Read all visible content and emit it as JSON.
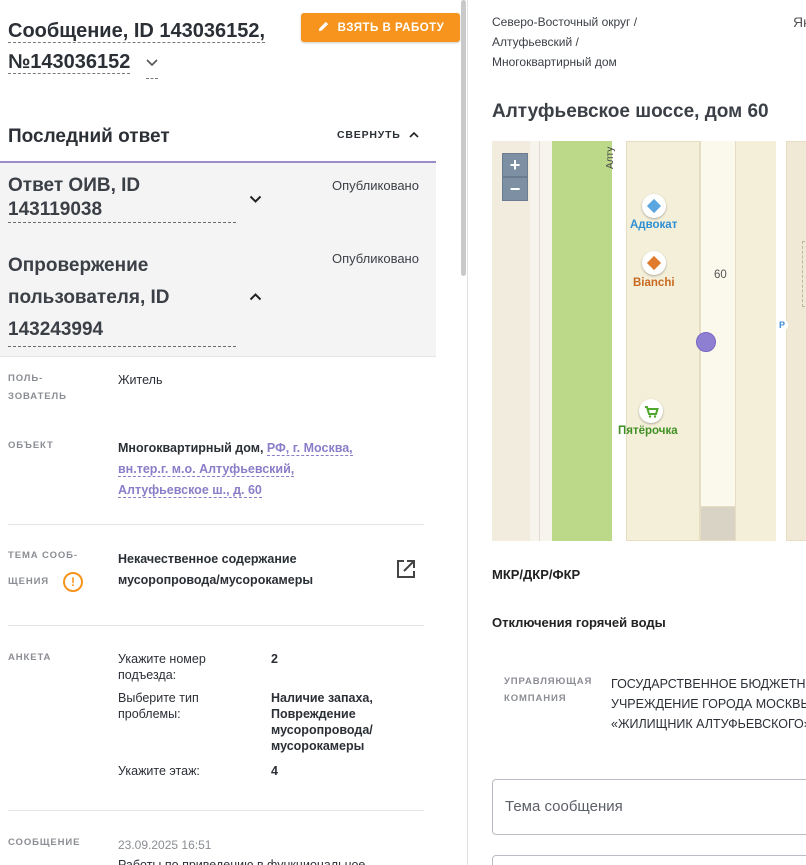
{
  "message": {
    "title_line1": "Сообщение, ID 143036152,",
    "title_line2": "№143036152",
    "take_button": "ВЗЯТЬ В РАБОТУ"
  },
  "last_answer": {
    "heading": "Последний ответ",
    "collapse_label": "СВЕРНУТЬ",
    "items": [
      {
        "title_line1": "Ответ ОИВ, ID",
        "title_line2": "143119038",
        "status": "Опубликовано"
      },
      {
        "title_line1": "Опровержение",
        "title_line2": "пользователя, ID",
        "title_line3": "143243994",
        "status": "Опубликовано"
      }
    ]
  },
  "details": {
    "user": {
      "label_line1": "ПОЛЬ-",
      "label_line2": "ЗОВАТЕЛЬ",
      "value": "Житель"
    },
    "object": {
      "label": "ОБЪЕКТ",
      "prefix": "Многоквартирный дом,",
      "link_line1": "РФ, г. Москва,",
      "link_line2": "вн.тер.г. м.о. Алтуфьевский,",
      "link_line3": "Алтуфьевское ш., д. 60"
    },
    "topic": {
      "label_line1": "ТЕМА СООБ-",
      "label_line2": "ЩЕНИЯ",
      "value_line1": "Некачественное содержание",
      "value_line2": "мусоропровода/мусорокамеры"
    },
    "survey": {
      "label": "АНКЕТА",
      "rows": [
        {
          "q": "Укажите номер подъезда:",
          "a": "2"
        },
        {
          "q": "Выберите тип проблемы:",
          "a": "Наличие запаха, Повреждение мусоропровода/ мусорокамеры"
        },
        {
          "q": "Укажите этаж:",
          "a": "4"
        }
      ]
    },
    "message_section": {
      "label": "СООБЩЕНИЕ",
      "date": "23.09.2025 16:51",
      "text": "Работы по приведению в функциональное"
    }
  },
  "right": {
    "breadcrumbs": [
      "Северо-Восточный округ /",
      "Алтуфьевский /",
      "Многоквартирный дом"
    ],
    "lang_stub": "Як",
    "address": "Алтуфьевское шоссе, дом 60",
    "map": {
      "zoom_in": "+",
      "zoom_out": "−",
      "street": "Алту",
      "house_number": "60",
      "poi": [
        {
          "name": "Адвокат",
          "color": "#2f8fd3"
        },
        {
          "name": "Bianchi",
          "color": "#e07a2c"
        },
        {
          "name": "Пятёрочка",
          "color": "#4ea72e"
        }
      ],
      "parking": "P"
    },
    "program_label": "МКР/ДКР/ФКР",
    "hot_water_label": "Отключения горячей воды",
    "management": {
      "label_line1": "УПРАВЛЯЮЩАЯ",
      "label_line2": "КОМПАНИЯ",
      "value_line1": "ГОСУДАРСТВЕННОЕ БЮДЖЕТНОЕ",
      "value_line2": "УЧРЕЖДЕНИЕ ГОРОДА МОСКВЫ",
      "value_line3": "«ЖИЛИЩНИК АЛТУФЬЕВСКОГО»"
    },
    "topic_input_placeholder": "Тема сообщения"
  },
  "colors": {
    "accent_orange": "#f7941d",
    "accent_purple": "#8b7dc7",
    "marker": "#8e7fd3"
  }
}
